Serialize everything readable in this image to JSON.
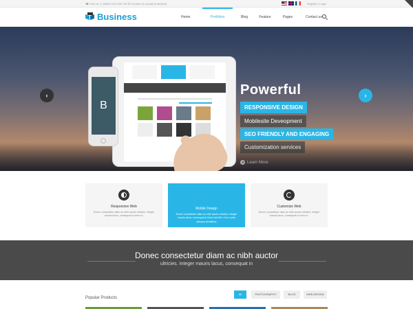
{
  "topbar": {
    "contact": "☎ Call Us: (+1888) 0123 456 789  ✉ Contact Us: [email protected]",
    "auth": "Register | Login"
  },
  "brand": {
    "name": "Business",
    "color": "#1b9fd6"
  },
  "nav": [
    {
      "label": "Home",
      "active": false
    },
    {
      "label": "Portfolios",
      "active": true
    },
    {
      "label": "Blog",
      "active": false
    },
    {
      "label": "Feature",
      "active": false
    },
    {
      "label": "Pages",
      "active": false
    },
    {
      "label": "Contact us",
      "active": false
    }
  ],
  "hero": {
    "headline": "Powerful",
    "tags": [
      "RESPONSIVE DESIGN",
      "Mobilesite Deveopment",
      "SEO FRIENDLY AND ENGAGING",
      "Customization services"
    ],
    "learn_more": "Learn More",
    "phone_letter": "B"
  },
  "services": [
    {
      "title": "Responsive Web",
      "desc": "Donec consectetur diam ac nibh auctor ultricies. Integer mauris lacus, consequat in tortor id.",
      "icon": "half-circle-icon"
    },
    {
      "title": "Mobile Design",
      "desc": "Donec consectetur diam ac nibh auctor ultricies. Integer mauris lacus, consequat in tortor sed ibh. Cum sociis natoque penatibus.",
      "icon": "mobile-icon"
    },
    {
      "title": "Customize Web",
      "desc": "Donec consectetur diam ac nibh auctor ultricies. Integer mauris lacus, consequat in tortor id.",
      "icon": "refresh-icon"
    }
  ],
  "band": {
    "heading": "Donec consectetur diam ac nibh auctor",
    "sub": "ultricies. Integer mauris lacus, consequat in"
  },
  "products": {
    "label": "Popular Products",
    "filters": [
      {
        "label": "All",
        "active": true
      },
      {
        "label": "PHOTOGRAPHY",
        "active": false
      },
      {
        "label": "BLOG",
        "active": false
      },
      {
        "label": "WEB DESIGN",
        "active": false
      }
    ]
  },
  "colors": {
    "accent": "#29b6e6",
    "dark": "#4a4a4a"
  }
}
